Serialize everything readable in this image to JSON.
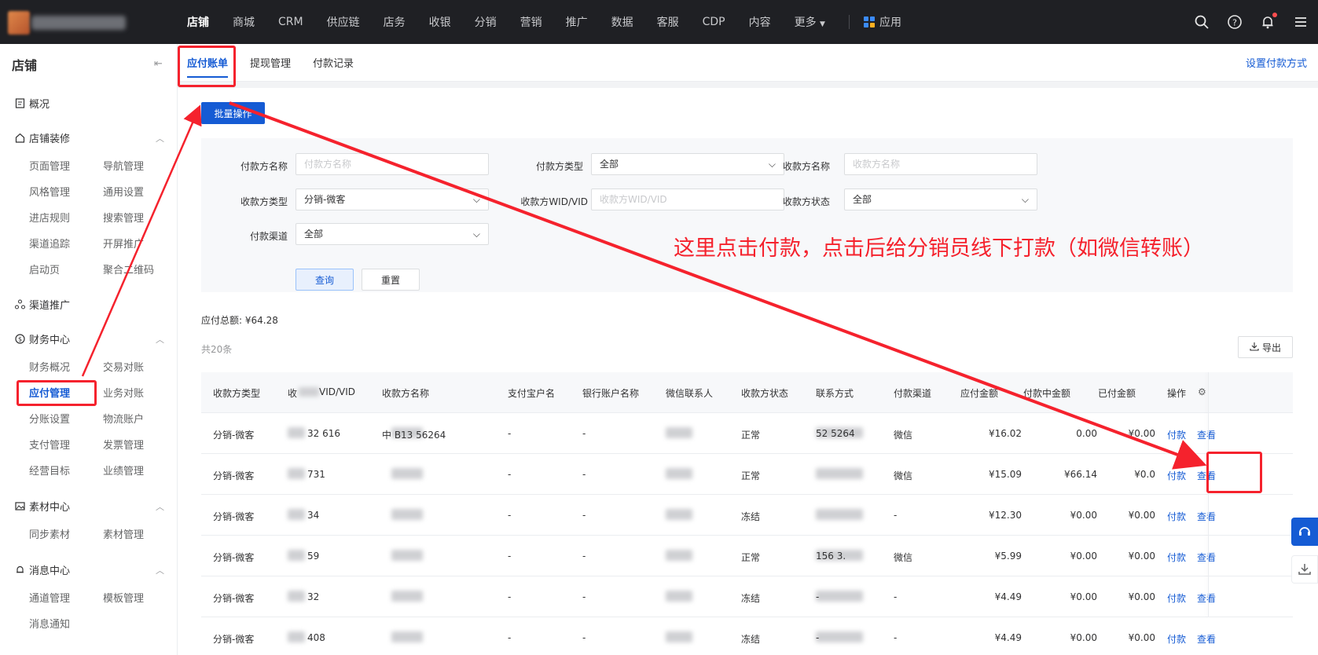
{
  "topnav": {
    "items": [
      "店铺",
      "商城",
      "CRM",
      "供应链",
      "店务",
      "收银",
      "分销",
      "营销",
      "推广",
      "数据",
      "客服",
      "CDP",
      "内容",
      "更多"
    ],
    "app_label": "应用"
  },
  "sidebar": {
    "title": "店铺",
    "overview": "概况",
    "groups": {
      "decor": "店铺装修",
      "channel": "渠道推广",
      "finance": "财务中心",
      "material": "素材中心",
      "message": "消息中心"
    },
    "decor_items": [
      "页面管理",
      "导航管理",
      "风格管理",
      "通用设置",
      "进店规则",
      "搜索管理",
      "渠道追踪",
      "开屏推广",
      "启动页",
      "聚合二维码"
    ],
    "finance_items": [
      "财务概况",
      "交易对账",
      "应付管理",
      "业务对账",
      "分账设置",
      "物流账户",
      "支付管理",
      "发票管理",
      "经营目标",
      "业绩管理"
    ],
    "material_items": [
      "同步素材",
      "素材管理"
    ],
    "message_items": [
      "通道管理",
      "模板管理",
      "消息通知"
    ]
  },
  "tabs": [
    "应付账单",
    "提现管理",
    "付款记录"
  ],
  "set_pay_method": "设置付款方式",
  "batch_label": "批量操作",
  "filters": {
    "payer_name_label": "付款方名称",
    "payer_name_placeholder": "付款方名称",
    "payer_type_label": "付款方类型",
    "payer_type_value": "全部",
    "payee_name_label": "收款方名称",
    "payee_name_placeholder": "收款方名称",
    "payee_type_label": "收款方类型",
    "payee_type_value": "分销-微客",
    "payee_wid_label": "收款方WID/VID",
    "payee_wid_placeholder": "收款方WID/VID",
    "payee_status_label": "收款方状态",
    "payee_status_value": "全部",
    "channel_label": "付款渠道",
    "channel_value": "全部",
    "query": "查询",
    "reset": "重置"
  },
  "total": "应付总额: ¥64.28",
  "count": "共20条",
  "export": "导出",
  "table": {
    "headers": [
      "收款方类型",
      "收",
      "VID/VID",
      "收款方名称",
      "支付宝户名",
      "银行账户名称",
      "微信联系人",
      "收款方状态",
      "联系方式",
      "付款渠道",
      "应付金额",
      "付款中金额",
      "已付金额",
      "操作"
    ],
    "rows": [
      {
        "type": "分销-微客",
        "vid": "32  616",
        "name": "中  B13  56264",
        "alipay": "-",
        "bank": "-",
        "status": "正常",
        "contact": "52  5264",
        "channel": "微信",
        "due": "¥16.02",
        "paying": "0.00",
        "paid": "¥0.00"
      },
      {
        "type": "分销-微客",
        "vid": "731",
        "name": "",
        "alipay": "-",
        "bank": "-",
        "status": "正常",
        "contact": "",
        "channel": "微信",
        "due": "¥15.09",
        "paying": "¥66.14",
        "paid": "¥0.0"
      },
      {
        "type": "分销-微客",
        "vid": "34",
        "name": "",
        "alipay": "-",
        "bank": "-",
        "status": "冻结",
        "contact": "",
        "channel": "-",
        "due": "¥12.30",
        "paying": "¥0.00",
        "paid": "¥0.00"
      },
      {
        "type": "分销-微客",
        "vid": "59",
        "name": "",
        "alipay": "-",
        "bank": "-",
        "status": "正常",
        "contact": "156  3.",
        "channel": "微信",
        "due": "¥5.99",
        "paying": "¥0.00",
        "paid": "¥0.00"
      },
      {
        "type": "分销-微客",
        "vid": "32",
        "name": "",
        "alipay": "-",
        "bank": "-",
        "status": "冻结",
        "contact": "-",
        "channel": "-",
        "due": "¥4.49",
        "paying": "¥0.00",
        "paid": "¥0.00"
      },
      {
        "type": "分销-微客",
        "vid": "408",
        "name": "",
        "alipay": "-",
        "bank": "-",
        "status": "冻结",
        "contact": "-",
        "channel": "-",
        "due": "¥4.49",
        "paying": "¥0.00",
        "paid": "¥0.00"
      }
    ],
    "pay_label": "付款",
    "view_label": "查看"
  },
  "annotation": "这里点击付款，点击后给分销员线下打款（如微信转账）",
  "colors": {
    "accent": "#155bd4",
    "annotation": "#f5222d",
    "topnav": "#1f2024"
  }
}
